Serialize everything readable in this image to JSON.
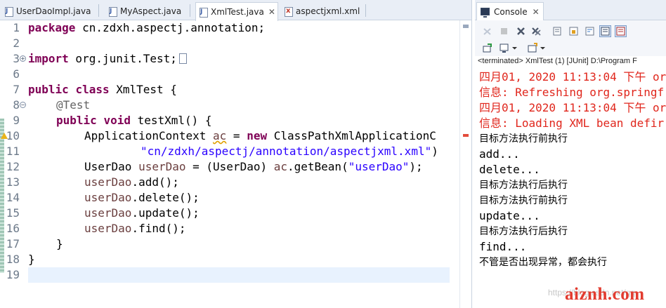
{
  "editor": {
    "tabs": [
      {
        "label": "UserDaoImpl.java",
        "type": "java",
        "active": false
      },
      {
        "label": "MyAspect.java",
        "type": "java",
        "active": false
      },
      {
        "label": "XmlTest.java",
        "type": "java",
        "active": true
      },
      {
        "label": "aspectjxml.xml",
        "type": "xml",
        "active": false
      }
    ],
    "close_glyph": "✕",
    "line_numbers": [
      "1",
      "2",
      "3",
      "6",
      "7",
      "8",
      "9",
      "10",
      "11",
      "12",
      "13",
      "14",
      "15",
      "16",
      "17",
      "18",
      "19"
    ],
    "code": {
      "l1_kw": "package",
      "l1_rest": " cn.zdxh.aspectj.annotation;",
      "l3_kw": "import",
      "l3_rest": " org.junit.Test;",
      "l7_kw1": "public",
      "l7_kw2": "class",
      "l7_rest": " XmlTest {",
      "l8_ann": "@Test",
      "l9_kw1": "public",
      "l9_kw2": "void",
      "l9_rest": " testXml() {",
      "l10_type": "ApplicationContext ",
      "l10_var": "ac",
      "l10_eq": " = ",
      "l10_kw": "new",
      "l10_rest": " ClassPathXmlApplicationC",
      "l11_str": "\"cn/zdxh/aspectj/annotation/aspectjxml.xml\"",
      "l11_rest": ")",
      "l12_type": "UserDao ",
      "l12_var": "userDao",
      "l12_mid": " = (UserDao) ",
      "l12_var2": "ac",
      "l12_call": ".getBean(",
      "l12_str": "\"userDao\"",
      "l12_end": ");",
      "l13_var": "userDao",
      "l13_call": ".add();",
      "l14_var": "userDao",
      "l14_call": ".delete();",
      "l15_var": "userDao",
      "l15_call": ".update();",
      "l16_var": "userDao",
      "l16_call": ".find();",
      "l17": "}",
      "l18": "}"
    }
  },
  "console": {
    "tab_label": "Console",
    "status": "<terminated> XmlTest (1) [JUnit] D:\\Program F",
    "lines": [
      {
        "text": "四月01, 2020 11:13:04 下午 or",
        "style": "err"
      },
      {
        "text": "信息: Refreshing org.springf",
        "style": "err"
      },
      {
        "text": "四月01, 2020 11:13:04 下午 or",
        "style": "err"
      },
      {
        "text": "信息: Loading XML bean defir",
        "style": "err"
      },
      {
        "text": "目标方法执行前执行",
        "style": "cjk"
      },
      {
        "text": "add...",
        "style": "plain"
      },
      {
        "text": "delete...",
        "style": "plain"
      },
      {
        "text": "目标方法执行后执行",
        "style": "cjk"
      },
      {
        "text": "目标方法执行前执行",
        "style": "cjk"
      },
      {
        "text": "update...",
        "style": "plain"
      },
      {
        "text": "目标方法执行后执行",
        "style": "cjk"
      },
      {
        "text": "find...",
        "style": "plain"
      },
      {
        "text": "不管是否出现异常，都会执行",
        "style": "cjk"
      }
    ]
  },
  "watermark": {
    "faint": "https://blog.csdn.net/qq",
    "brand": "aiznh.com"
  },
  "colors": {
    "keyword": "#7f0055",
    "string": "#2a00ff",
    "error": "#e0261c",
    "current_line": "#e8f2fe",
    "watermark": "#e23b2f"
  }
}
